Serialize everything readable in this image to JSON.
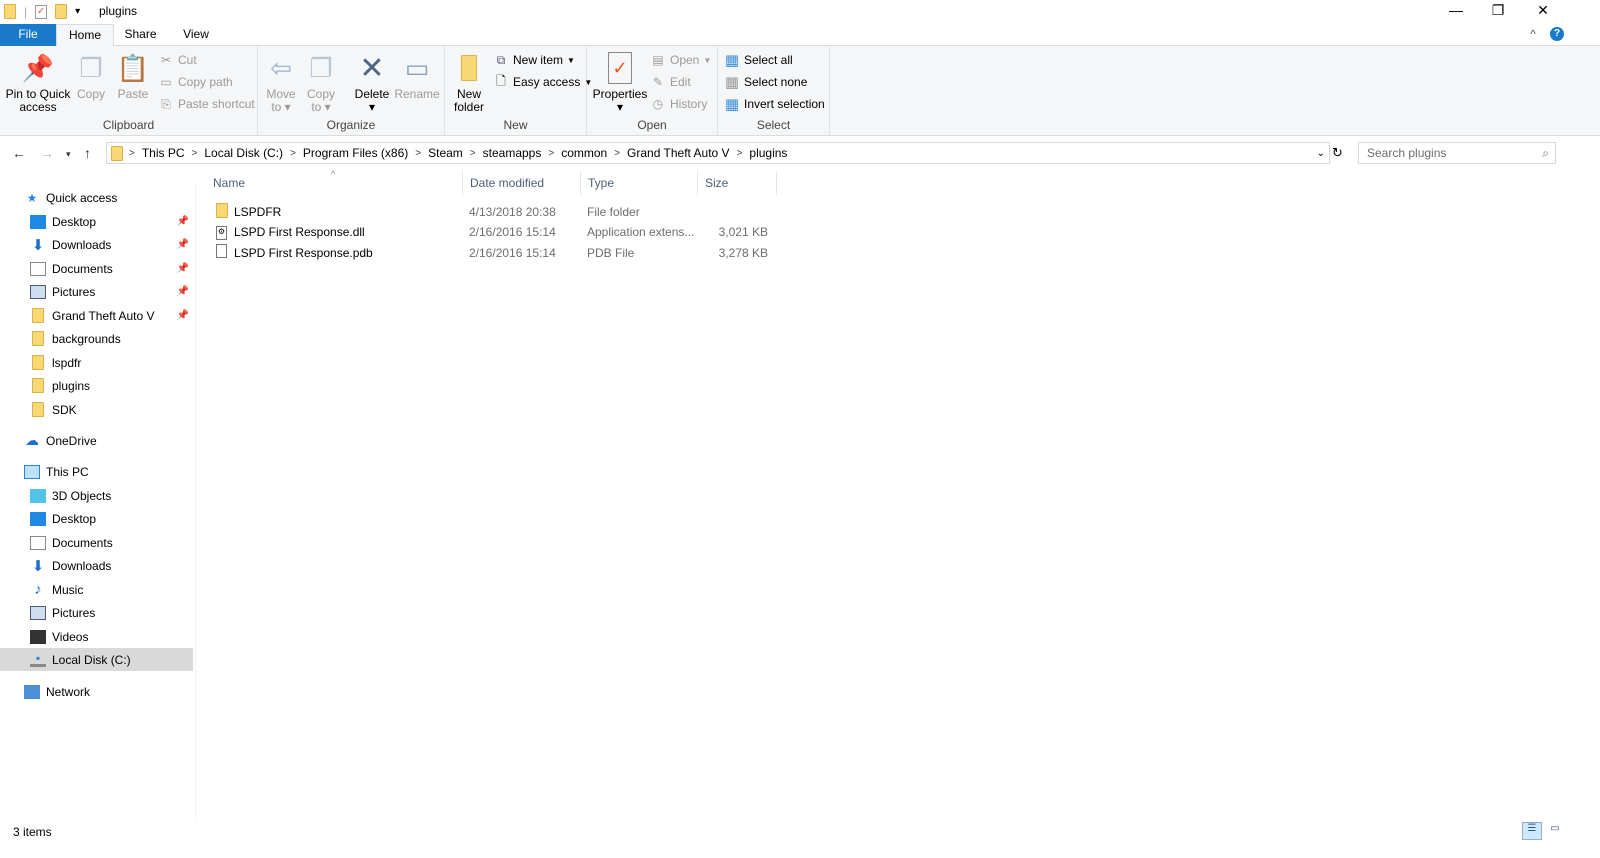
{
  "window": {
    "title": "plugins",
    "minimize": "—",
    "restore": "❐",
    "close": "✕"
  },
  "tabs": {
    "file": "File",
    "home": "Home",
    "share": "Share",
    "view": "View"
  },
  "ribbon": {
    "clipboard": {
      "label": "Clipboard",
      "pin": "Pin to Quick access",
      "copy": "Copy",
      "paste": "Paste",
      "cut": "Cut",
      "copy_path": "Copy path",
      "paste_shortcut": "Paste shortcut"
    },
    "organize": {
      "label": "Organize",
      "move_to": "Move to",
      "copy_to": "Copy to",
      "delete": "Delete",
      "rename": "Rename"
    },
    "new": {
      "label": "New",
      "new_folder": "New folder",
      "new_item": "New item",
      "easy_access": "Easy access"
    },
    "open": {
      "label": "Open",
      "properties": "Properties",
      "open": "Open",
      "edit": "Edit",
      "history": "History"
    },
    "select": {
      "label": "Select",
      "select_all": "Select all",
      "select_none": "Select none",
      "invert": "Invert selection"
    }
  },
  "address": {
    "crumbs": [
      "This PC",
      "Local Disk (C:)",
      "Program Files (x86)",
      "Steam",
      "steamapps",
      "common",
      "Grand Theft Auto V",
      "plugins"
    ],
    "search_placeholder": "Search plugins"
  },
  "nav": {
    "quick_access": "Quick access",
    "quick": [
      "Desktop",
      "Downloads",
      "Documents",
      "Pictures",
      "Grand Theft Auto V",
      "backgrounds",
      "lspdfr",
      "plugins",
      "SDK"
    ],
    "onedrive": "OneDrive",
    "this_pc": "This PC",
    "pc": [
      "3D Objects",
      "Desktop",
      "Documents",
      "Downloads",
      "Music",
      "Pictures",
      "Videos",
      "Local Disk (C:)"
    ],
    "network": "Network"
  },
  "columns": {
    "name": "Name",
    "date": "Date modified",
    "type": "Type",
    "size": "Size"
  },
  "files": [
    {
      "name": "LSPDFR",
      "date": "4/13/2018 20:38",
      "type": "File folder",
      "size": ""
    },
    {
      "name": "LSPD First Response.dll",
      "date": "2/16/2016 15:14",
      "type": "Application extens...",
      "size": "3,021 KB"
    },
    {
      "name": "LSPD First Response.pdb",
      "date": "2/16/2016 15:14",
      "type": "PDB File",
      "size": "3,278 KB"
    }
  ],
  "status": {
    "count": "3 items"
  }
}
